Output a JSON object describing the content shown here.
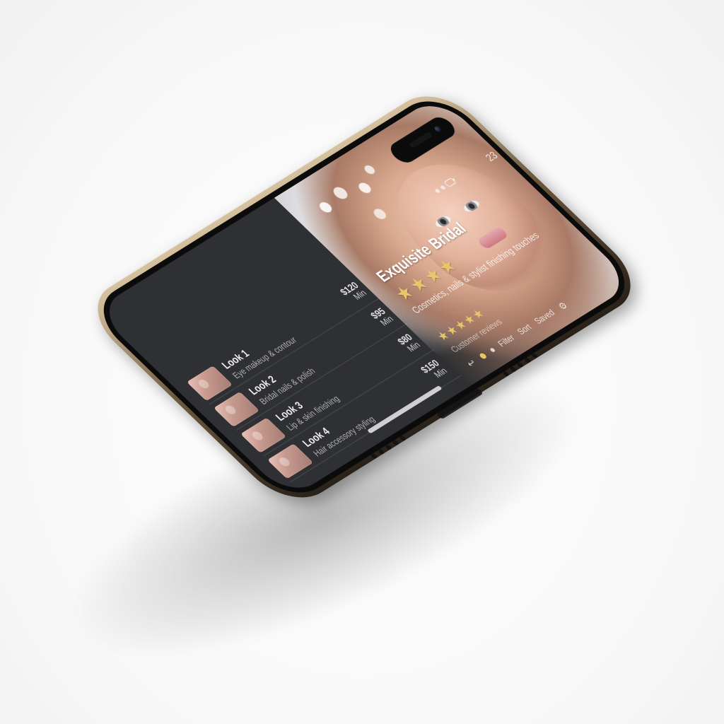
{
  "hero": {
    "title": "Exquisite Bridal",
    "stars": "★★★★",
    "subtitle": "Cosmetics, nails & stylist finishing touches"
  },
  "rating": {
    "stars": "★★★★★",
    "meta": "Customer reviews"
  },
  "controls": {
    "left_label": "Filter",
    "mid_label": "Sort",
    "right_label": "Saved"
  },
  "status": {
    "time": "23"
  },
  "list": [
    {
      "title": "Look 1",
      "subtitle": "Eye makeup & contour",
      "price": "$120",
      "meta": "Min"
    },
    {
      "title": "Look 2",
      "subtitle": "Bridal nails & polish",
      "price": "$95",
      "meta": "Min"
    },
    {
      "title": "Look 3",
      "subtitle": "Lip & skin finishing",
      "price": "$80",
      "meta": "Min"
    },
    {
      "title": "Look 4",
      "subtitle": "Hair accessory styling",
      "price": "$150",
      "meta": "Min"
    }
  ],
  "icons": {
    "back": "back-icon",
    "settings": "settings-icon"
  }
}
